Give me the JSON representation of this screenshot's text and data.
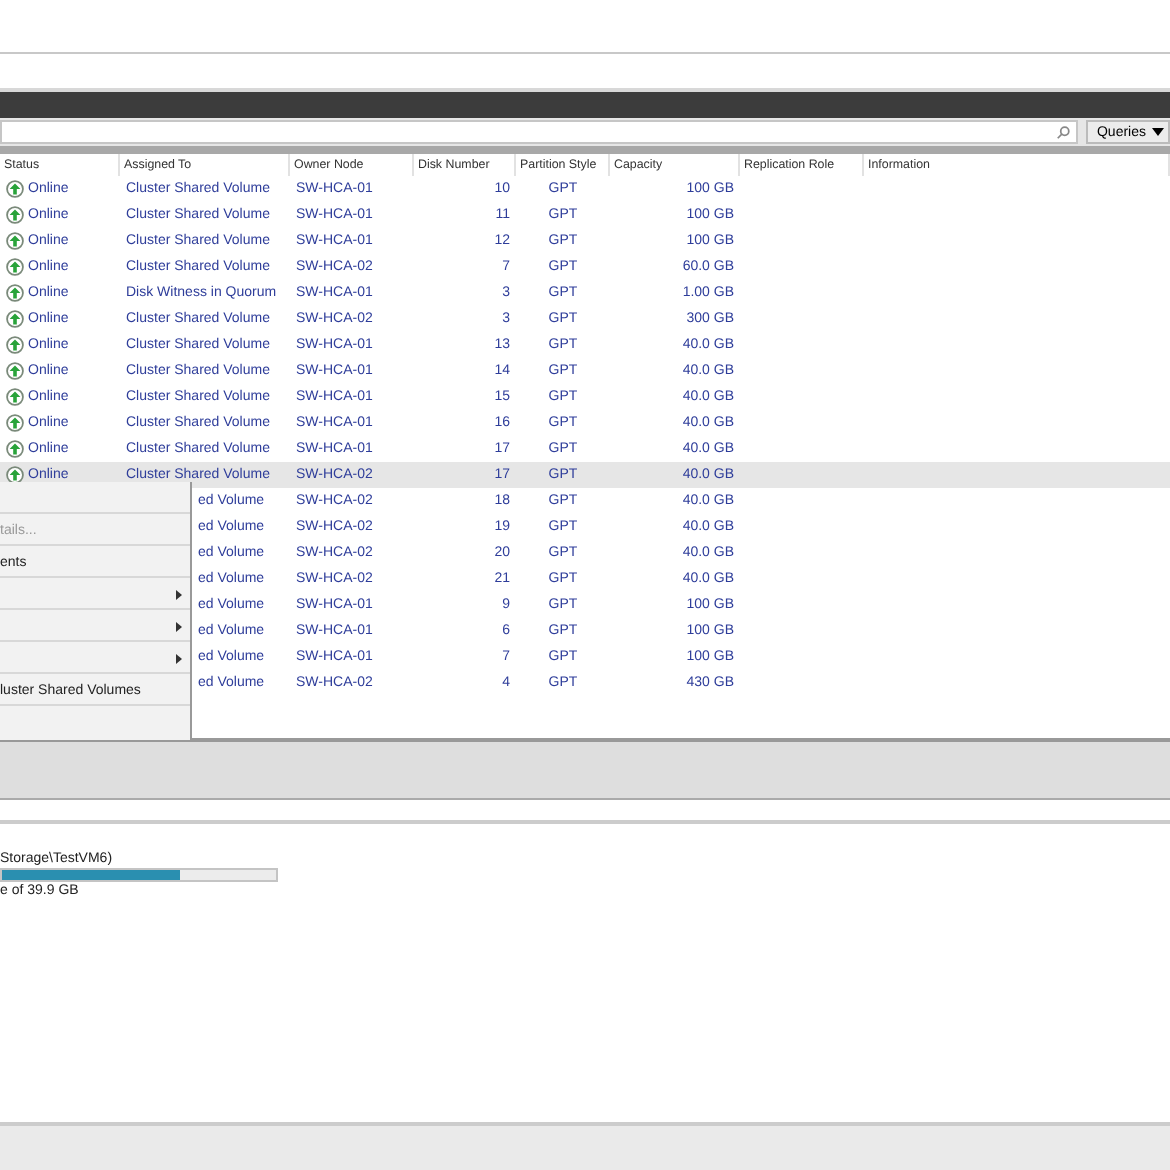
{
  "toolbar": {
    "queries_button": "Queries"
  },
  "table": {
    "columns": [
      "Status",
      "Assigned To",
      "Owner Node",
      "Disk Number",
      "Partition Style",
      "Capacity",
      "Replication Role",
      "Information"
    ],
    "rows": [
      {
        "status": "Online",
        "assigned": "Cluster Shared Volume",
        "owner": "SW-HCA-01",
        "disk": "10",
        "style": "GPT",
        "capacity": "100 GB",
        "selected": false,
        "covered": false
      },
      {
        "status": "Online",
        "assigned": "Cluster Shared Volume",
        "owner": "SW-HCA-01",
        "disk": "11",
        "style": "GPT",
        "capacity": "100 GB",
        "selected": false,
        "covered": false
      },
      {
        "status": "Online",
        "assigned": "Cluster Shared Volume",
        "owner": "SW-HCA-01",
        "disk": "12",
        "style": "GPT",
        "capacity": "100 GB",
        "selected": false,
        "covered": false
      },
      {
        "status": "Online",
        "assigned": "Cluster Shared Volume",
        "owner": "SW-HCA-02",
        "disk": "7",
        "style": "GPT",
        "capacity": "60.0 GB",
        "selected": false,
        "covered": false
      },
      {
        "status": "Online",
        "assigned": "Disk Witness in Quorum",
        "owner": "SW-HCA-01",
        "disk": "3",
        "style": "GPT",
        "capacity": "1.00 GB",
        "selected": false,
        "covered": false
      },
      {
        "status": "Online",
        "assigned": "Cluster Shared Volume",
        "owner": "SW-HCA-02",
        "disk": "3",
        "style": "GPT",
        "capacity": "300 GB",
        "selected": false,
        "covered": false
      },
      {
        "status": "Online",
        "assigned": "Cluster Shared Volume",
        "owner": "SW-HCA-01",
        "disk": "13",
        "style": "GPT",
        "capacity": "40.0 GB",
        "selected": false,
        "covered": false
      },
      {
        "status": "Online",
        "assigned": "Cluster Shared Volume",
        "owner": "SW-HCA-01",
        "disk": "14",
        "style": "GPT",
        "capacity": "40.0 GB",
        "selected": false,
        "covered": false
      },
      {
        "status": "Online",
        "assigned": "Cluster Shared Volume",
        "owner": "SW-HCA-01",
        "disk": "15",
        "style": "GPT",
        "capacity": "40.0 GB",
        "selected": false,
        "covered": false
      },
      {
        "status": "Online",
        "assigned": "Cluster Shared Volume",
        "owner": "SW-HCA-01",
        "disk": "16",
        "style": "GPT",
        "capacity": "40.0 GB",
        "selected": false,
        "covered": false
      },
      {
        "status": "Online",
        "assigned": "Cluster Shared Volume",
        "owner": "SW-HCA-01",
        "disk": "17",
        "style": "GPT",
        "capacity": "40.0 GB",
        "selected": false,
        "covered": false
      },
      {
        "status": "Online",
        "assigned": "Cluster Shared Volume",
        "owner": "SW-HCA-02",
        "disk": "17",
        "style": "GPT",
        "capacity": "40.0 GB",
        "selected": true,
        "covered": false
      },
      {
        "assigned": "ed Volume",
        "owner": "SW-HCA-02",
        "disk": "18",
        "style": "GPT",
        "capacity": "40.0 GB",
        "selected": false,
        "covered": true
      },
      {
        "assigned": "ed Volume",
        "owner": "SW-HCA-02",
        "disk": "19",
        "style": "GPT",
        "capacity": "40.0 GB",
        "selected": false,
        "covered": true
      },
      {
        "assigned": "ed Volume",
        "owner": "SW-HCA-02",
        "disk": "20",
        "style": "GPT",
        "capacity": "40.0 GB",
        "selected": false,
        "covered": true
      },
      {
        "assigned": "ed Volume",
        "owner": "SW-HCA-02",
        "disk": "21",
        "style": "GPT",
        "capacity": "40.0 GB",
        "selected": false,
        "covered": true
      },
      {
        "assigned": "ed Volume",
        "owner": "SW-HCA-01",
        "disk": "9",
        "style": "GPT",
        "capacity": "100 GB",
        "selected": false,
        "covered": true
      },
      {
        "assigned": "ed Volume",
        "owner": "SW-HCA-01",
        "disk": "6",
        "style": "GPT",
        "capacity": "100 GB",
        "selected": false,
        "covered": true
      },
      {
        "assigned": "ed Volume",
        "owner": "SW-HCA-01",
        "disk": "7",
        "style": "GPT",
        "capacity": "100 GB",
        "selected": false,
        "covered": true
      },
      {
        "assigned": "ed Volume",
        "owner": "SW-HCA-02",
        "disk": "4",
        "style": "GPT",
        "capacity": "430 GB",
        "selected": false,
        "covered": true
      }
    ]
  },
  "context_menu": {
    "items": [
      {
        "kind": "blank"
      },
      {
        "kind": "text",
        "text": "tails...",
        "disabled": true
      },
      {
        "kind": "text",
        "text": "ents",
        "disabled": false
      },
      {
        "kind": "submenu"
      },
      {
        "kind": "submenu"
      },
      {
        "kind": "submenu"
      },
      {
        "kind": "text",
        "text": "luster Shared Volumes",
        "disabled": false
      }
    ]
  },
  "details": {
    "volume": "Storage\\TestVM6)",
    "level": 0.65,
    "free": "e of 39.9 GB"
  }
}
